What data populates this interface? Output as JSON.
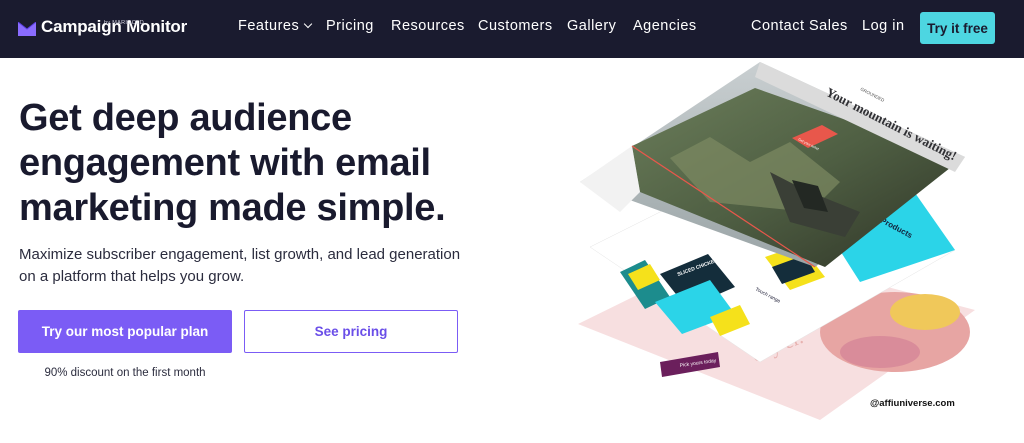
{
  "header": {
    "logo_text": "Campaign Monitor",
    "logo_sub": "by MARIGOLD",
    "nav": {
      "features": "Features",
      "pricing": "Pricing",
      "resources": "Resources",
      "customers": "Customers",
      "gallery": "Gallery",
      "agencies": "Agencies",
      "contact_sales": "Contact Sales",
      "log_in": "Log in"
    },
    "cta": "Try it free"
  },
  "hero": {
    "title": "Get deep audience engagement with email marketing made simple.",
    "subtitle": "Maximize subscriber engagement, list growth, and lead generation on a platform that helps you grow.",
    "primary_button": "Try our most popular plan",
    "secondary_button": "See pricing",
    "discount_note": "90% discount on the first month"
  },
  "illustration": {
    "top_card_heading": "Your mountain is waiting!",
    "top_card_brand": "GROUNDED",
    "top_card_button": "Get your ticket",
    "products_label": "Products",
    "touch_label": "Touch range",
    "sliced_label": "SLICED CHICKEN",
    "bottom_button": "Pick yours today",
    "bottom_script": "day er.",
    "colors": {
      "cyan": "#2bd4e8",
      "yellow": "#f5e11b",
      "pink": "#f6dede",
      "purple": "#6b1f5c",
      "coral": "#e8574b"
    }
  },
  "watermark": "@affiuniverse.com",
  "colors": {
    "nav_bg": "#1a1b2f",
    "accent_purple": "#7b5cf5",
    "accent_cyan": "#4dd6e1"
  }
}
